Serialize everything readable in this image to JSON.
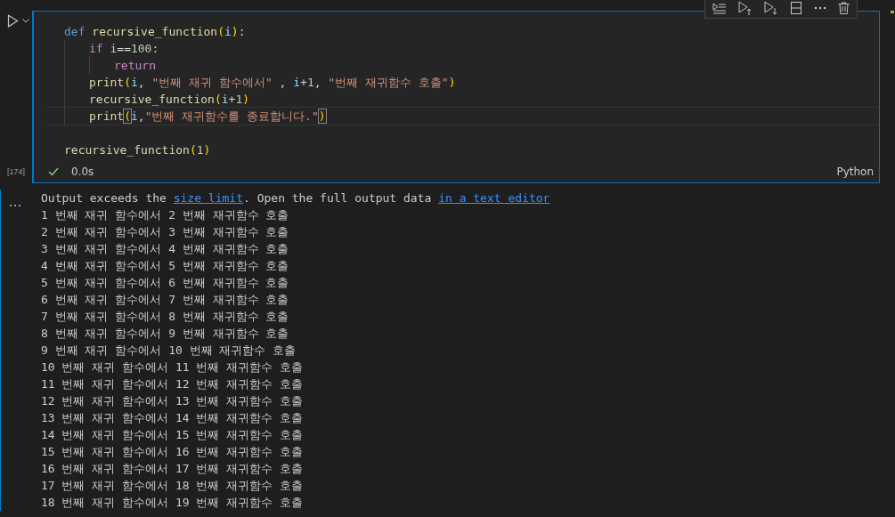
{
  "cell": {
    "execution_count": "[174]",
    "succeeded": true,
    "duration": "0.0s",
    "language": "Python",
    "toolbar": [
      {
        "kind": "run-by-line"
      },
      {
        "kind": "run-above"
      },
      {
        "kind": "run-below"
      },
      {
        "kind": "split"
      },
      {
        "kind": "more"
      },
      {
        "kind": "delete"
      }
    ],
    "code_sections": [
      {
        "lines": [
          {
            "words": [
              [
                {
                  "kind": "keyword",
                  "text": "def"
                }
              ],
              [
                {
                  "kind": "function",
                  "text": "recursive_function"
                },
                {
                  "kind": "paren",
                  "text": "("
                },
                {
                  "kind": "variable",
                  "text": "i"
                },
                {
                  "kind": "paren",
                  "text": ")"
                },
                {
                  "kind": "plain",
                  "text": ":"
                }
              ]
            ],
            "children": [
              {
                "words": [
                  [
                    {
                      "kind": "control",
                      "text": "if"
                    }
                  ],
                  [
                    {
                      "kind": "variable",
                      "text": "i"
                    },
                    {
                      "kind": "plain",
                      "text": "=="
                    },
                    {
                      "kind": "number",
                      "text": "100"
                    },
                    {
                      "kind": "plain",
                      "text": ":"
                    }
                  ]
                ],
                "children": [
                  {
                    "words": [
                      [
                        {
                          "kind": "control",
                          "text": "return"
                        }
                      ]
                    ]
                  }
                ]
              },
              {
                "words": [
                  [
                    {
                      "kind": "function",
                      "text": "print"
                    },
                    {
                      "kind": "paren",
                      "text": "("
                    },
                    {
                      "kind": "variable",
                      "text": "i"
                    },
                    {
                      "kind": "plain",
                      "text": ","
                    }
                  ],
                  [
                    {
                      "kind": "string",
                      "text": "\"번째 재귀 함수에서\""
                    }
                  ],
                  [
                    {
                      "kind": "plain",
                      "text": ","
                    }
                  ],
                  [
                    {
                      "kind": "variable",
                      "text": "i"
                    },
                    {
                      "kind": "plain",
                      "text": "+"
                    },
                    {
                      "kind": "number",
                      "text": "1"
                    },
                    {
                      "kind": "plain",
                      "text": ","
                    }
                  ],
                  [
                    {
                      "kind": "string",
                      "text": "\"번째 재귀함수 호출\""
                    },
                    {
                      "kind": "paren",
                      "text": ")"
                    }
                  ]
                ]
              },
              {
                "words": [
                  [
                    {
                      "kind": "function",
                      "text": "recursive_function"
                    },
                    {
                      "kind": "paren",
                      "text": "("
                    },
                    {
                      "kind": "variable",
                      "text": "i"
                    },
                    {
                      "kind": "plain",
                      "text": "+"
                    },
                    {
                      "kind": "number",
                      "text": "1"
                    },
                    {
                      "kind": "paren",
                      "text": ")"
                    }
                  ]
                ]
              },
              {
                "current": true,
                "words": [
                  [
                    {
                      "kind": "function",
                      "text": "print"
                    },
                    {
                      "kind": "match",
                      "text": "("
                    },
                    {
                      "kind": "variable",
                      "text": "i"
                    },
                    {
                      "kind": "plain",
                      "text": ","
                    },
                    {
                      "kind": "string",
                      "text": "\"번째 재귀함수를 종료합니다.\""
                    },
                    {
                      "kind": "match",
                      "text": ")"
                    }
                  ]
                ]
              }
            ]
          }
        ]
      },
      {
        "lines": [
          {
            "words": [
              [
                {
                  "kind": "function",
                  "text": "recursive_function"
                },
                {
                  "kind": "paren",
                  "text": "("
                },
                {
                  "kind": "number",
                  "text": "1"
                },
                {
                  "kind": "paren",
                  "text": ")"
                }
              ]
            ]
          }
        ]
      }
    ]
  },
  "output": {
    "notice": [
      {
        "kind": "text",
        "text": "Output exceeds the "
      },
      {
        "kind": "link",
        "text": "size limit"
      },
      {
        "kind": "text",
        "text": ". Open the full output data "
      },
      {
        "kind": "link",
        "text": "in a text editor"
      }
    ],
    "lines": [
      "1 번째 재귀 함수에서 2 번째 재귀함수 호출",
      "2 번째 재귀 함수에서 3 번째 재귀함수 호출",
      "3 번째 재귀 함수에서 4 번째 재귀함수 호출",
      "4 번째 재귀 함수에서 5 번째 재귀함수 호출",
      "5 번째 재귀 함수에서 6 번째 재귀함수 호출",
      "6 번째 재귀 함수에서 7 번째 재귀함수 호출",
      "7 번째 재귀 함수에서 8 번째 재귀함수 호출",
      "8 번째 재귀 함수에서 9 번째 재귀함수 호출",
      "9 번째 재귀 함수에서 10 번째 재귀함수 호출",
      "10 번째 재귀 함수에서 11 번째 재귀함수 호출",
      "11 번째 재귀 함수에서 12 번째 재귀함수 호출",
      "12 번째 재귀 함수에서 13 번째 재귀함수 호출",
      "13 번째 재귀 함수에서 14 번째 재귀함수 호출",
      "14 번째 재귀 함수에서 15 번째 재귀함수 호출",
      "15 번째 재귀 함수에서 16 번째 재귀함수 호출",
      "16 번째 재귀 함수에서 17 번째 재귀함수 호출",
      "17 번째 재귀 함수에서 18 번째 재귀함수 호출",
      "18 번째 재귀 함수에서 19 번째 재귀함수 호출"
    ]
  }
}
